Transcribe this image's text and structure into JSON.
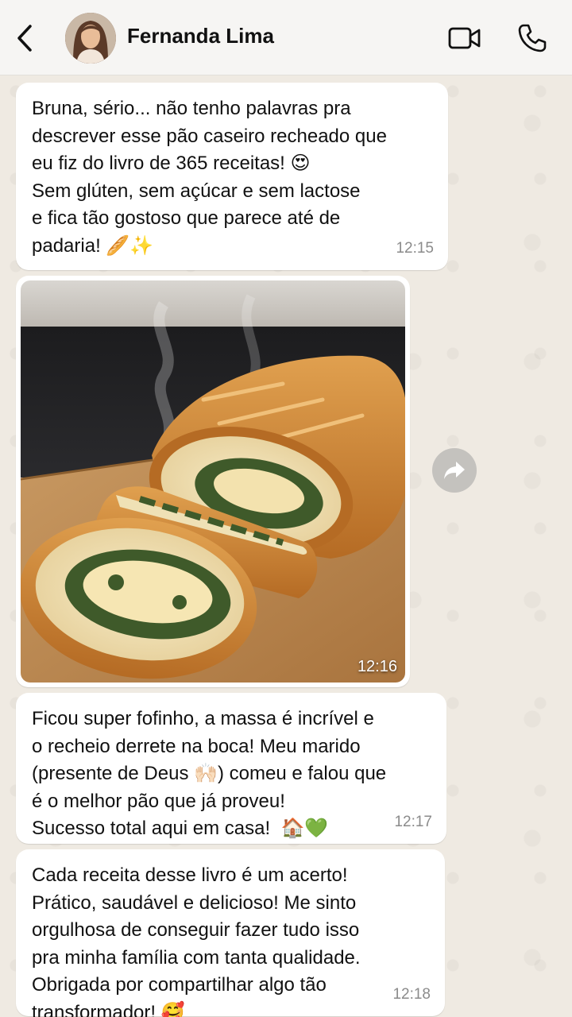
{
  "header": {
    "contact_name": "Fernanda Lima",
    "icons": [
      "back-arrow-icon",
      "avatar",
      "video-call-icon",
      "phone-call-icon"
    ]
  },
  "messages": [
    {
      "text": "Bruna, sério... não tenho palavras pra\ndescrever esse pão caseiro recheado que\neu fiz do livro de 365 receitas! 😍\nSem glúten, sem açúcar e sem lactose\ne fica tão gostoso que parece até de\npadaria! 🥖✨",
      "time": "12:15"
    },
    {
      "type": "image",
      "image_subject": "stuffed-bread-photo",
      "time": "12:16"
    },
    {
      "text": "Ficou super fofinho, a massa é incrível e\no recheio derrete na boca! Meu marido\n(presente de Deus 🙌🏻) comeu e falou que\né o melhor pão que já proveu!\nSucesso total aqui em casa!  🏠💚",
      "time": "12:17"
    },
    {
      "text": "Cada receita desse livro é um acerto!\nPrático, saudável e delicioso! Me sinto\norgulhosa de conseguir fazer tudo isso\npra minha família com tanta qualidade.\nObrigada por compartilhar algo tão\ntransformador! 🥰",
      "time": "12:18"
    }
  ],
  "colors": {
    "chat_background": "#efeae2",
    "bubble": "#ffffff",
    "header": "#f6f5f3",
    "timestamp": "#8b8b8b"
  }
}
